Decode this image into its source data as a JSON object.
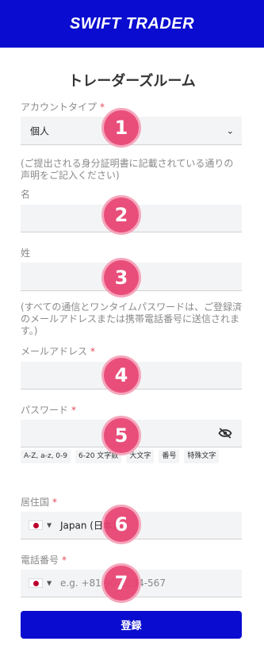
{
  "header": {
    "logo": "SWIFT TRADER"
  },
  "page": {
    "title": "トレーダーズルーム"
  },
  "account_type": {
    "label": "アカウントタイプ",
    "required": "*",
    "value": "個人"
  },
  "name_note": "(ご提出される身分証明書に記載されている通りの声明をご記入ください)",
  "first_name": {
    "label": "名"
  },
  "last_name": {
    "label": "姓"
  },
  "contact_note": "(すべての通信とワンタイムパスワードは、ご登録済のメールアドレスまたは携帯電話番号に送信されます。)",
  "email": {
    "label": "メールアドレス",
    "required": "*"
  },
  "password": {
    "label": "パスワード",
    "required": "*",
    "hints": [
      "A-Z, a-z, 0-9",
      "6-20 文字数",
      "大文字",
      "番号",
      "特殊文字"
    ]
  },
  "country": {
    "label": "居住国",
    "required": "*",
    "value": "Japan (日本)"
  },
  "phone": {
    "label": "電話番号",
    "required": "*",
    "placeholder": "e.g. +81 90-1234-567"
  },
  "submit": {
    "label": "登録"
  },
  "badges": [
    "1",
    "2",
    "3",
    "4",
    "5",
    "6",
    "7"
  ],
  "colors": {
    "brand": "#0a0ccf",
    "required": "#e44a5a",
    "badge": "#e8416f"
  }
}
